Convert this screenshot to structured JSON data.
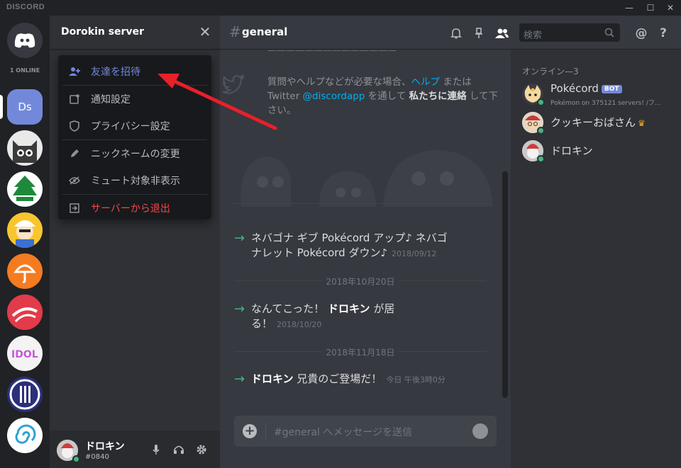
{
  "app": {
    "brand": "DISCORD"
  },
  "rail": {
    "online_count": "1 ONLINE",
    "active_server": "Ds"
  },
  "server": {
    "name": "Dorokin server"
  },
  "menu": {
    "items": [
      {
        "label": "友達を招待",
        "icon": "add-user-icon"
      },
      {
        "label": "通知設定",
        "icon": "bell-icon"
      },
      {
        "label": "プライバシー設定",
        "icon": "shield-icon"
      },
      {
        "label": "ニックネームの変更",
        "icon": "pencil-icon"
      },
      {
        "label": "ミュート対象非表示",
        "icon": "eye-off-icon"
      },
      {
        "label": "サーバーから退出",
        "icon": "exit-icon"
      }
    ]
  },
  "user": {
    "name": "ドロキン",
    "tag": "#0840"
  },
  "channel": {
    "hash": "#",
    "name": "general"
  },
  "search": {
    "placeholder": "検索"
  },
  "chat": {
    "help_prefix": "質問やヘルプなどが必要な場合、",
    "help_link": "ヘルプ",
    "help_mid1": " または Twitter ",
    "help_handle": "@discordapp",
    "help_mid2": " を通して ",
    "help_bold": "私たちに連絡",
    "help_suffix": " して下さい。",
    "messages": [
      {
        "text_line1": "ネバゴナ ギブ Pokécord アップ♪ ネバゴ",
        "text_line2": "ナレット Pokécord ダウン♪",
        "timestamp": "2018/09/12"
      },
      {
        "prefix": "なんてこった！ ",
        "strong": "ドロキン",
        "suffix_line1": " が居",
        "suffix_line2": "る！",
        "timestamp": "2018/10/20"
      },
      {
        "strong": "ドロキン",
        "suffix": " 兄貴のご登場だ！",
        "timestamp": "今日 午後3時0分"
      }
    ],
    "dividers": [
      "2018年10月20日",
      "2018年11月18日"
    ],
    "composer_placeholder": "#general へメッセージを送信"
  },
  "members": {
    "header": "オンライン—3",
    "list": [
      {
        "name": "Pokécord",
        "badge": "BOT",
        "activity": "Pokémon on 375121 servers! /フ..."
      },
      {
        "name": "クッキーおばさん",
        "crown": "♛"
      },
      {
        "name": "ドロキン"
      }
    ]
  },
  "colors": {
    "accent": "#7289da",
    "danger": "#f04747",
    "online": "#43b581",
    "arrow": "#e8202a"
  }
}
